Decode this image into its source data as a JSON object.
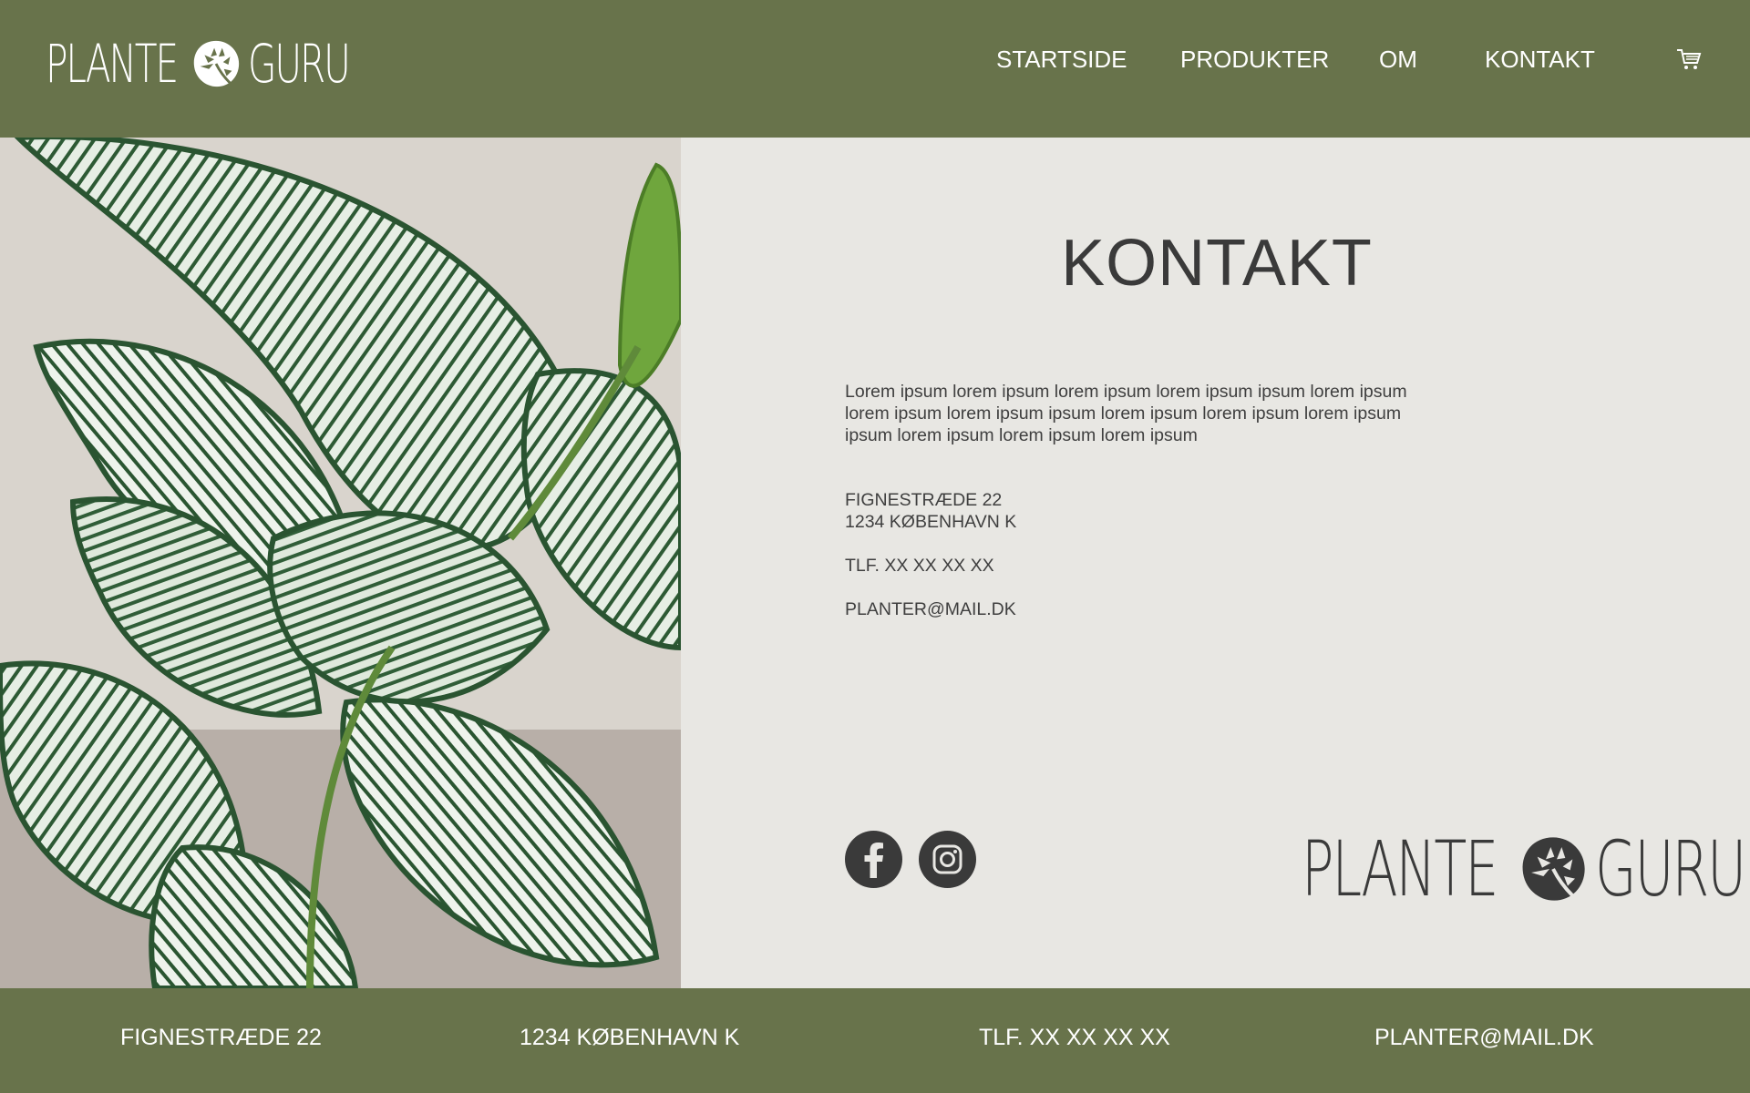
{
  "brand": {
    "word1": "PLANTE",
    "word2": "GURU"
  },
  "nav": {
    "items": [
      {
        "label": "STARTSIDE"
      },
      {
        "label": "PRODUKTER"
      },
      {
        "label": "OM"
      },
      {
        "label": "KONTAKT"
      }
    ],
    "cart_icon": "shopping-cart-icon"
  },
  "main": {
    "title": "KONTAKT",
    "lorem_lines": [
      "Lorem ipsum lorem ipsum lorem ipsum lorem ipsum ipsum lorem ipsum",
      "lorem ipsum lorem ipsum ipsum lorem ipsum lorem ipsum lorem ipsum",
      "ipsum lorem ipsum lorem ipsum lorem ipsum"
    ],
    "address_line1": "FIGNESTRÆDE 22",
    "address_line2": "1234 KØBENHAVN K",
    "phone": "TLF. XX XX XX XX",
    "email": "PLANTER@MAIL.DK",
    "social": [
      "facebook-icon",
      "instagram-icon"
    ]
  },
  "footer": {
    "address": "FIGNESTRÆDE 22",
    "city": "1234 KØBENHAVN K",
    "phone": "TLF. XX XX XX XX",
    "email": "PLANTER@MAIL.DK"
  },
  "colors": {
    "header_bg": "#68734b",
    "content_bg": "#e8e7e3",
    "text": "#3a3a3a",
    "leaf_dark": "#2f5a35",
    "leaf_light": "#e4ece2"
  }
}
